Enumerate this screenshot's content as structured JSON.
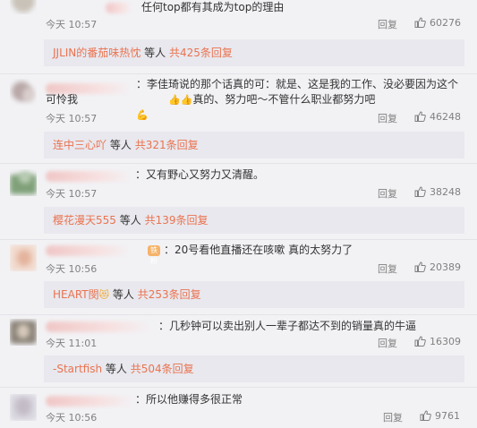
{
  "common": {
    "reply_label": "回复",
    "etc_label": "等人"
  },
  "comments": [
    {
      "text": "任何top都有其成为top的理由",
      "time": "今天 10:57",
      "likes": "60276",
      "sub": {
        "who": "JJLIN的番茄味热忱",
        "count": "共425条回复"
      }
    },
    {
      "text_pre": "：李佳琦说的那个话真的可：就是、这是我的工作、没必要因为这个可怜我",
      "emoji1": "👍👍",
      "text_mid": "真的、努力吧～不管什么职业都努力吧",
      "emoji2": "💪",
      "time": "今天 10:57",
      "likes": "46248",
      "sub": {
        "who": "连中三心吖",
        "count": "共321条回复"
      }
    },
    {
      "text": "：又有野心又努力又清醒。",
      "time": "今天 10:57",
      "likes": "38248",
      "sub": {
        "who": "樱花漫天555",
        "count": "共139条回复"
      }
    },
    {
      "badge": "铁粉",
      "text": "：20号看他直播还在咳嗽 真的太努力了",
      "time": "今天 10:56",
      "likes": "20389",
      "sub": {
        "who": "HEART閔",
        "who_emoji": "😻",
        "count": "共253条回复"
      }
    },
    {
      "text": "：几秒钟可以卖出别人一辈子都达不到的销量真的牛逼",
      "time": "今天 11:01",
      "likes": "16309",
      "sub": {
        "who": "-Startfish",
        "count": "共504条回复"
      }
    },
    {
      "text": "：所以他赚得多很正常",
      "time": "今天 10:56",
      "likes": "9761"
    }
  ]
}
